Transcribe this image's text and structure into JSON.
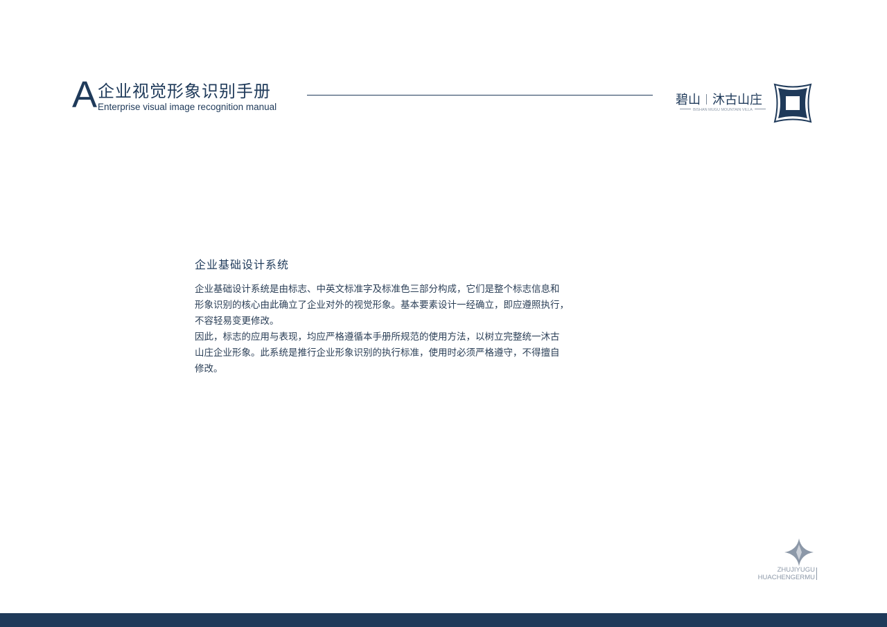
{
  "header": {
    "letter": "A",
    "title_cn": "企业视觉形象识别手册",
    "title_en": "Enterprise visual image recognition manual"
  },
  "logo": {
    "name_left": "碧山",
    "name_right": "沐古山庄",
    "subtitle": "BISHAN MUGU MOUNTAIN VILLA",
    "mark_icon": "square-frame-logo-icon",
    "color": "#1f3a5a"
  },
  "content": {
    "title": "企业基础设计系统",
    "paragraph1_lines": [
      "企业基础设计系统是由标志、中英文标准字及标准色三部分构成，它们是整个标志信息和",
      "形象识别的核心由此确立了企业对外的视觉形象。基本要素设计一经确立，即应遵照执行，",
      "不容轻易变更修改。"
    ],
    "paragraph2_lines": [
      "因此，标志的应用与表现，均应严格遵循本手册所规范的使用方法，以树立完整统一沐古",
      "山庄企业形象。此系统是推行企业形象识别的执行标准，使用时必须严格遵守，不得擅自",
      "修改。"
    ]
  },
  "footer": {
    "mark_icon": "four-point-star-icon",
    "line1": "ZHUJIYUGU",
    "line2": "HUACHENGERMU",
    "band_color": "#1f3a5a"
  }
}
